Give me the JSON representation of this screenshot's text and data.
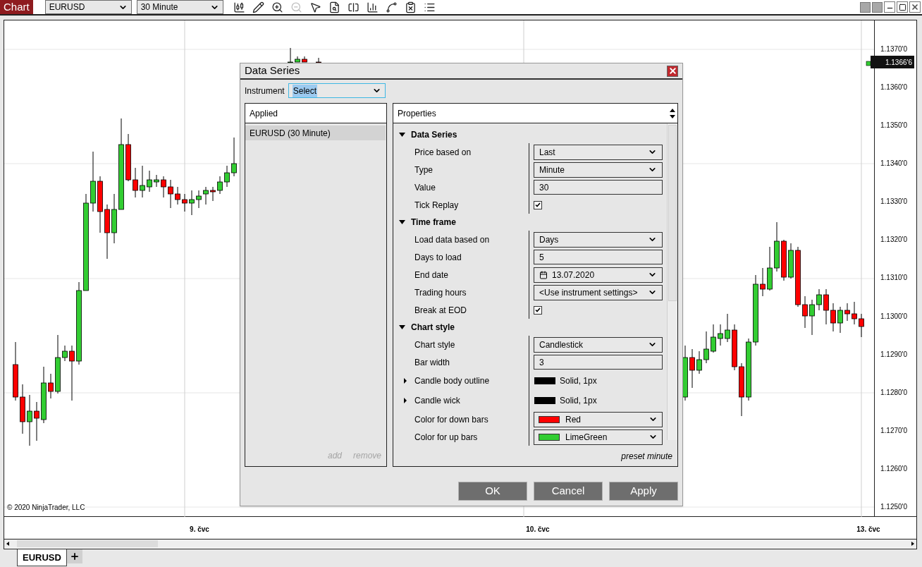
{
  "toolbar": {
    "title": "Chart",
    "instrument": "EURUSD",
    "interval": "30 Minute",
    "tools": [
      {
        "kind": "candles",
        "disabled": false
      },
      {
        "kind": "pencil",
        "disabled": false
      },
      {
        "kind": "zoom_in",
        "disabled": false
      },
      {
        "kind": "zoom_out",
        "disabled": true
      },
      {
        "kind": "pointer",
        "disabled": false
      },
      {
        "kind": "data_box",
        "disabled": false
      },
      {
        "kind": "panels",
        "disabled": false
      },
      {
        "kind": "volume",
        "disabled": false
      },
      {
        "kind": "indicators",
        "disabled": false
      },
      {
        "kind": "strategies",
        "disabled": false
      },
      {
        "kind": "properties",
        "disabled": false
      }
    ]
  },
  "chart": {
    "price_axis": [
      "1.1370'0",
      "1.1360'0",
      "1.1350'0",
      "1.1340'0",
      "1.1330'0",
      "1.1320'0",
      "1.1310'0",
      "1.1300'0",
      "1.1290'0",
      "1.1280'0",
      "1.1270'0",
      "1.1260'0",
      "1.1250'0"
    ],
    "last_price": "1.1366'6",
    "date_labels": [
      "9. čvc",
      "10. čvc",
      "13. čvc"
    ],
    "copyright": "© 2020 NinjaTrader, LLC"
  },
  "tabs": [
    {
      "label": "EURUSD",
      "selected": true
    }
  ],
  "dialog": {
    "title": "Data Series",
    "instrument_label": "Instrument",
    "instrument_value": "Select",
    "applied": {
      "header": "Applied",
      "items": [
        {
          "label": "EURUSD (30 Minute)",
          "selected": true
        }
      ],
      "actions": [
        {
          "label": "add",
          "disabled": true
        },
        {
          "label": "remove",
          "disabled": true
        }
      ]
    },
    "properties": {
      "header": "Properties",
      "sections": [
        {
          "title": "Data Series",
          "expanded": true,
          "rows": [
            {
              "label": "Price based on",
              "kind": "select",
              "value": "Last"
            },
            {
              "label": "Type",
              "kind": "select",
              "value": "Minute"
            },
            {
              "label": "Value",
              "kind": "text",
              "value": "30"
            },
            {
              "label": "Tick Replay",
              "kind": "checkbox",
              "checked": true
            }
          ]
        },
        {
          "title": "Time frame",
          "expanded": true,
          "rows": [
            {
              "label": "Load data based on",
              "kind": "select",
              "value": "Days"
            },
            {
              "label": "Days to load",
              "kind": "text",
              "value": "5"
            },
            {
              "label": "End date",
              "kind": "date",
              "value": "13.07.2020"
            },
            {
              "label": "Trading hours",
              "kind": "select",
              "value": "<Use instrument settings>"
            },
            {
              "label": "Break at EOD",
              "kind": "checkbox",
              "checked": true
            }
          ]
        },
        {
          "title": "Chart style",
          "expanded": true,
          "rows": [
            {
              "label": "Chart style",
              "kind": "select",
              "value": "Candlestick"
            },
            {
              "label": "Bar width",
              "kind": "text",
              "value": "3"
            },
            {
              "label": "Candle body outline",
              "kind": "stroke",
              "expanded": false,
              "color": "#000000",
              "value": "Solid, 1px"
            },
            {
              "label": "Candle wick",
              "kind": "stroke",
              "expanded": false,
              "color": "#000000",
              "value": "Solid, 1px"
            },
            {
              "label": "Color for down bars",
              "kind": "color",
              "color": "#ff0000",
              "value": "Red"
            },
            {
              "label": "Color for up bars",
              "kind": "color",
              "color": "#32cd32",
              "value": "LimeGreen"
            }
          ]
        }
      ],
      "preset": "preset minute"
    },
    "buttons": [
      "OK",
      "Cancel",
      "Apply"
    ]
  }
}
